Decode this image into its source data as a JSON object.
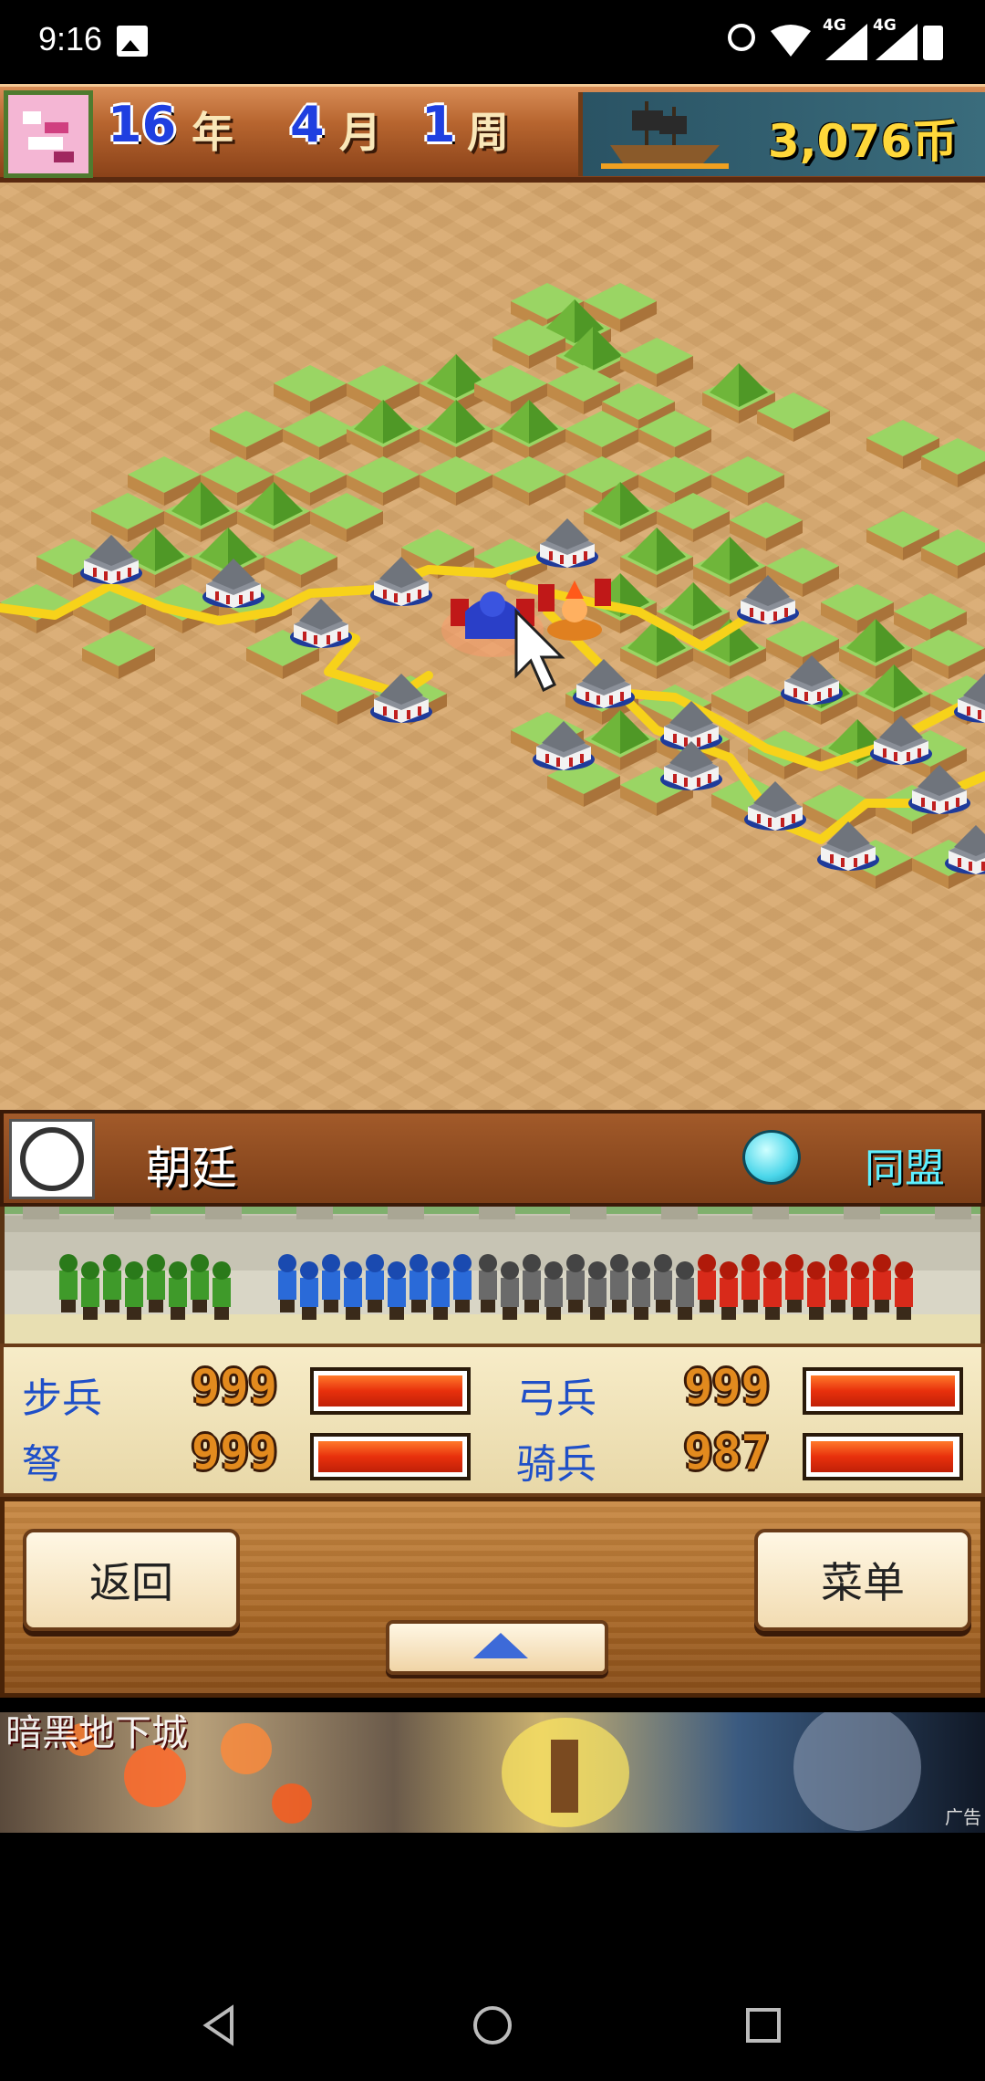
{
  "status_bar": {
    "time": "9:16",
    "network_1": "4G",
    "network_2": "4G",
    "icons": [
      "gallery-icon",
      "alarm-icon",
      "wifi-icon",
      "signal-icon",
      "signal-icon",
      "battery-icon"
    ]
  },
  "top_bar": {
    "year_value": "16",
    "year_unit": "年",
    "month_value": "4",
    "month_unit": "月",
    "week_value": "1",
    "week_unit": "周",
    "money": "3,076币"
  },
  "faction": {
    "name": "朝廷",
    "status": "同盟"
  },
  "stats": [
    {
      "label": "步兵",
      "value": "999",
      "fill": 1.0
    },
    {
      "label": "弓兵",
      "value": "999",
      "fill": 1.0
    },
    {
      "label": "弩",
      "value": "999",
      "fill": 1.0
    },
    {
      "label": "骑兵",
      "value": "987",
      "fill": 0.99
    }
  ],
  "controls": {
    "back_label": "返回",
    "menu_label": "菜单"
  },
  "ad": {
    "title": "暗黑地下城",
    "tag": "广告"
  },
  "colors": {
    "sand": "#d9a96e",
    "grass": "#93d15a",
    "road": "#f7d21a",
    "stat_label": "#1f4fc8",
    "faction_status": "#5ef0ff"
  }
}
